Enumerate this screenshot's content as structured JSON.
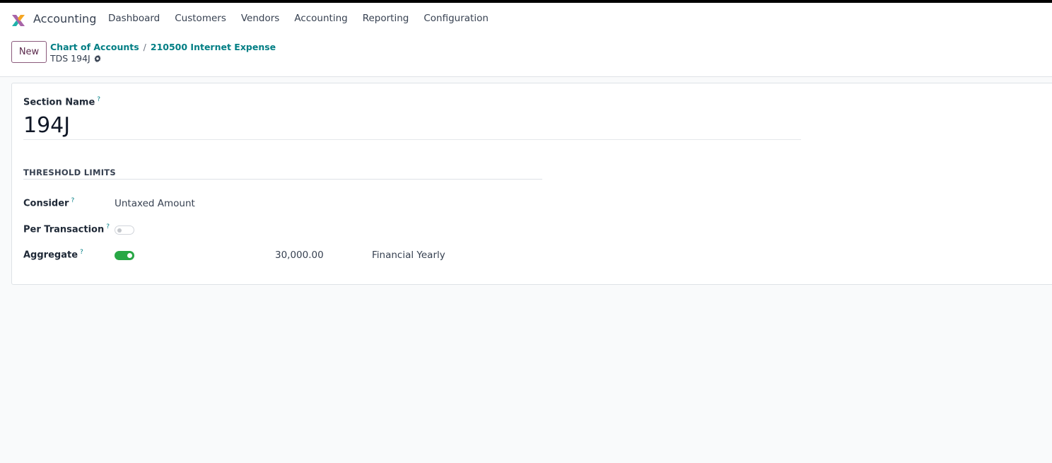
{
  "app": {
    "name": "Accounting"
  },
  "menu": {
    "items": [
      {
        "label": "Dashboard"
      },
      {
        "label": "Customers"
      },
      {
        "label": "Vendors"
      },
      {
        "label": "Accounting"
      },
      {
        "label": "Reporting"
      },
      {
        "label": "Configuration"
      }
    ]
  },
  "control_panel": {
    "new_label": "New",
    "breadcrumbs": [
      "Chart of Accounts",
      "210500 Internet Expense"
    ],
    "separator": "/",
    "record_name": "TDS 194J"
  },
  "form": {
    "section_name_label": "Section Name",
    "section_name_value": "194J",
    "help_marker": "?",
    "group_title": "THRESHOLD LIMITS",
    "consider": {
      "label": "Consider",
      "value": "Untaxed Amount"
    },
    "per_transaction": {
      "label": "Per Transaction",
      "enabled": false
    },
    "aggregate": {
      "label": "Aggregate",
      "enabled": true,
      "amount": "30,000.00",
      "period": "Financial Yearly"
    }
  },
  "colors": {
    "accent": "#017e84",
    "toggle_on": "#28a745",
    "new_button_border": "#8b5a7c"
  }
}
